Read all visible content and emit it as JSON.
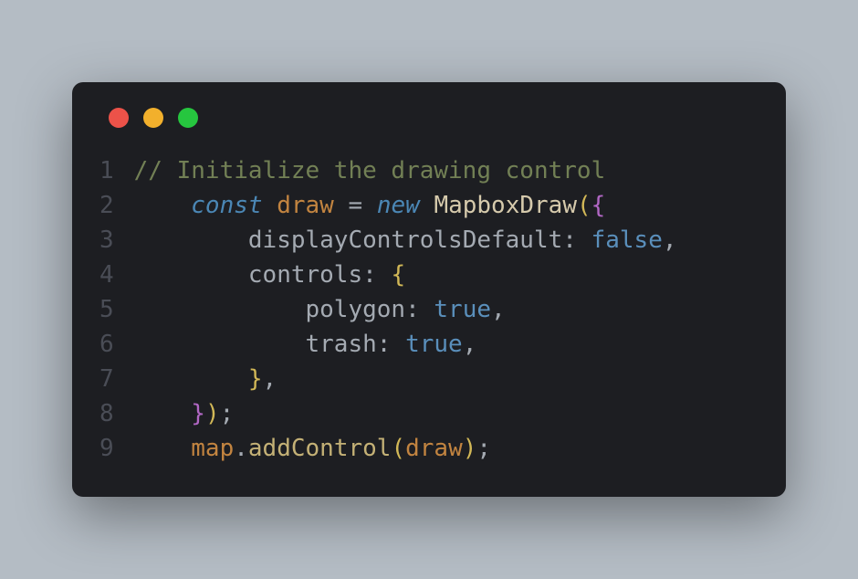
{
  "traffic_lights": {
    "red_name": "close-icon",
    "yellow_name": "minimize-icon",
    "green_name": "maximize-icon"
  },
  "colors": {
    "background": "#b4bcc4",
    "editor": "#1d1e22",
    "gutter": "#4a4d56",
    "comment": "#728055",
    "keyword": "#4b87b5",
    "declared": "#c28440",
    "class": "#d6caac",
    "bool": "#5a8fbb",
    "text": "#a4aab2"
  },
  "line_numbers": [
    "1",
    "2",
    "3",
    "4",
    "5",
    "6",
    "7",
    "8",
    "9"
  ],
  "code": {
    "l1": {
      "comment": "// Initialize the drawing control"
    },
    "l2": {
      "indent": "    ",
      "kw1": "const",
      "sp1": " ",
      "name": "draw",
      "sp2": " ",
      "eq": "=",
      "sp3": " ",
      "kw2": "new",
      "sp4": " ",
      "cls": "MapboxDraw",
      "p1": "(",
      "b1": "{"
    },
    "l3": {
      "indent": "        ",
      "prop": "displayControlsDefault",
      "colon": ":",
      "sp": " ",
      "val": "false",
      "comma": ","
    },
    "l4": {
      "indent": "        ",
      "prop": "controls",
      "colon": ":",
      "sp": " ",
      "b1": "{"
    },
    "l5": {
      "indent": "            ",
      "prop": "polygon",
      "colon": ":",
      "sp": " ",
      "val": "true",
      "comma": ","
    },
    "l6": {
      "indent": "            ",
      "prop": "trash",
      "colon": ":",
      "sp": " ",
      "val": "true",
      "comma": ","
    },
    "l7": {
      "indent": "        ",
      "b1": "}",
      "comma": ","
    },
    "l8": {
      "indent": "    ",
      "b1": "}",
      "p1": ")",
      "semi": ";"
    },
    "l9": {
      "indent": "    ",
      "obj": "map",
      "dot": ".",
      "method": "addControl",
      "p1": "(",
      "arg": "draw",
      "p2": ")",
      "semi": ";"
    }
  }
}
